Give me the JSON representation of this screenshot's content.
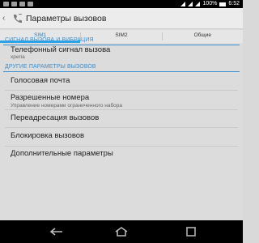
{
  "status_bar": {
    "battery_percent": "100%",
    "time": "6:52"
  },
  "action_bar": {
    "back_glyph": "‹",
    "title": "Параметры вызовов"
  },
  "tabs": [
    {
      "label": "SIM1",
      "active": true
    },
    {
      "label": "SIM2",
      "active": false
    },
    {
      "label": "Общие",
      "active": false
    }
  ],
  "sections": {
    "call_signal": {
      "header": "СИГНАЛ ВЫЗОВА И ВИБРАЦИЯ",
      "ringtone_title": "Телефонный сигнал вызова",
      "ringtone_value": "xperia"
    },
    "other": {
      "header": "ДРУГИЕ ПАРАМЕТРЫ ВЫЗОВОВ",
      "items": [
        {
          "title": "Голосовая почта",
          "subtitle": ""
        },
        {
          "title": "Разрешенные номера",
          "subtitle": "Управление номерами ограниченного набора"
        },
        {
          "title": "Переадресация вызовов",
          "subtitle": ""
        },
        {
          "title": "Блокировка вызовов",
          "subtitle": ""
        },
        {
          "title": "Дополнительные параметры",
          "subtitle": ""
        }
      ]
    }
  },
  "colors": {
    "accent": "#2aa3e8",
    "section_header": "#3b8fd1",
    "background": "#dcdcdc"
  },
  "icons": {
    "back": "back-icon",
    "app": "phone-settings-icon",
    "nav_back": "back-arrow-icon",
    "nav_home": "home-icon",
    "nav_recent": "recent-apps-icon"
  }
}
